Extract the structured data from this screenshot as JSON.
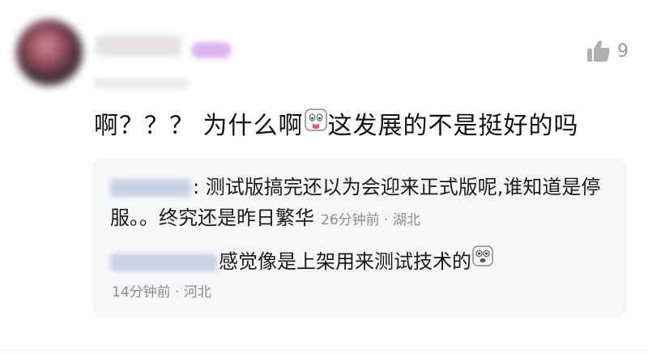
{
  "comment": {
    "avatar_icon": "avatar-blurred",
    "username": "",
    "like_icon": "thumbs-up-icon",
    "like_count": "9",
    "text_part1": "啊？？？ 为什么啊",
    "emoji1": "crying-face-icon",
    "text_part2": "这发展的不是挺好的吗"
  },
  "replies": [
    {
      "text": ": 测试版搞完还以为会迎来正式版呢,谁知道是停服。。终究还是昨日繁华",
      "meta": "26分钟前 · 湖北"
    },
    {
      "text": "感觉像是上架用来测试技术的",
      "emoji": "surprised-face-icon",
      "meta": "14分钟前 · 河北"
    }
  ],
  "colors": {
    "reply_box_bg": "#f6f7f9",
    "meta_text": "#8d8d8d",
    "like_icon": "#b0b0b0"
  }
}
